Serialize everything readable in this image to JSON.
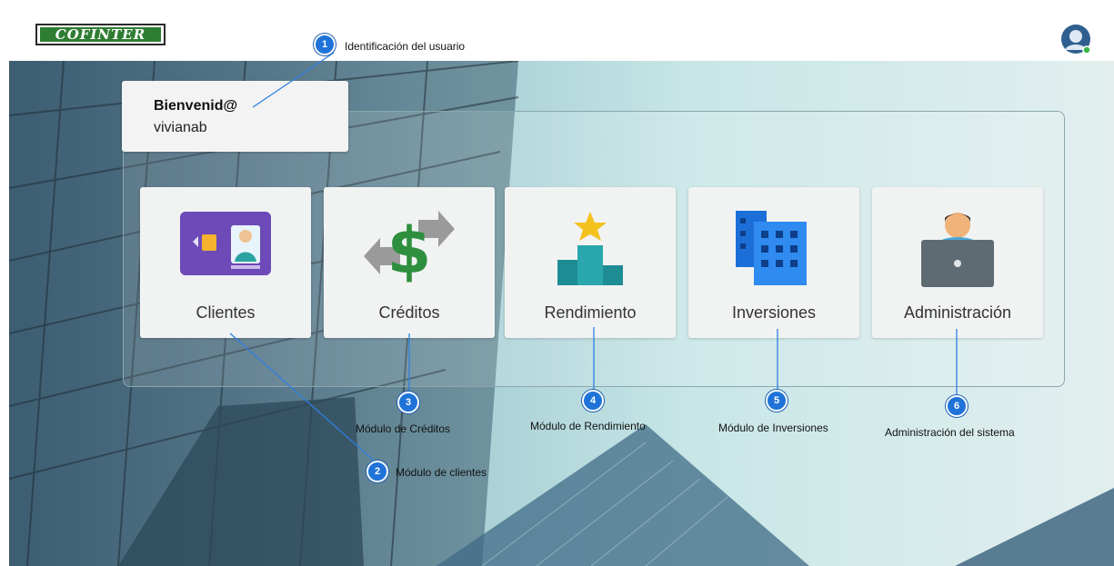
{
  "header": {
    "logo_text": "COFINTER",
    "avatar_icon": "user-avatar-icon"
  },
  "welcome": {
    "title": "Bienvenid@",
    "username": "vivianab"
  },
  "modules": [
    {
      "label": "Clientes",
      "icon": "id-card-icon"
    },
    {
      "label": "Créditos",
      "icon": "dollar-exchange-icon"
    },
    {
      "label": "Rendimiento",
      "icon": "podium-star-icon"
    },
    {
      "label": "Inversiones",
      "icon": "buildings-icon"
    },
    {
      "label": "Administración",
      "icon": "admin-laptop-icon"
    }
  ],
  "annotations": [
    {
      "number": "1",
      "text": "Identificación del usuario"
    },
    {
      "number": "2",
      "text": "Módulo de clientes"
    },
    {
      "number": "3",
      "text": "Módulo de Créditos"
    },
    {
      "number": "4",
      "text": "Módulo de Rendimiento"
    },
    {
      "number": "5",
      "text": "Módulo de Inversiones"
    },
    {
      "number": "6",
      "text": "Administración del sistema"
    }
  ],
  "colors": {
    "accent": "#1f73d8",
    "logo_green": "#2f7d33"
  }
}
